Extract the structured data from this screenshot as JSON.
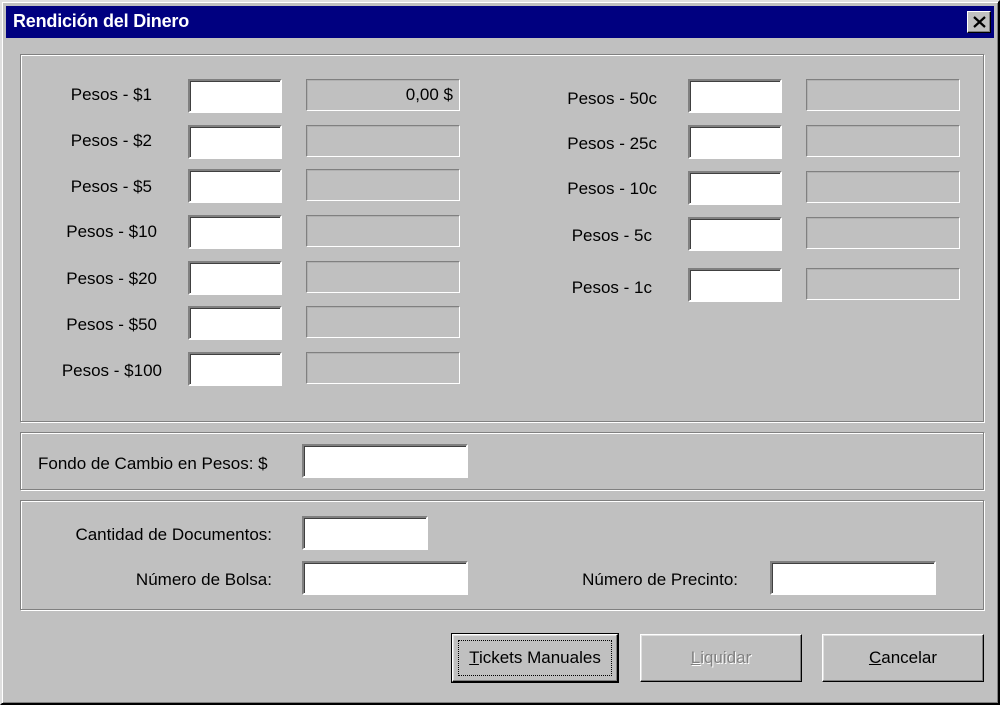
{
  "window": {
    "title": "Rendición del Dinero",
    "close_glyph": "close-icon"
  },
  "billetes": [
    {
      "label": "Pesos - $1",
      "value": "",
      "total": "0,00 $"
    },
    {
      "label": "Pesos - $2",
      "value": "",
      "total": ""
    },
    {
      "label": "Pesos - $5",
      "value": "",
      "total": ""
    },
    {
      "label": "Pesos - $10",
      "value": "",
      "total": ""
    },
    {
      "label": "Pesos - $20",
      "value": "",
      "total": ""
    },
    {
      "label": "Pesos - $50",
      "value": "",
      "total": ""
    },
    {
      "label": "Pesos - $100",
      "value": "",
      "total": ""
    }
  ],
  "monedas": [
    {
      "label": "Pesos - 50c",
      "value": "",
      "total": ""
    },
    {
      "label": "Pesos - 25c",
      "value": "",
      "total": ""
    },
    {
      "label": "Pesos - 10c",
      "value": "",
      "total": ""
    },
    {
      "label": "Pesos - 5c",
      "value": "",
      "total": ""
    },
    {
      "label": "Pesos - 1c",
      "value": "",
      "total": ""
    }
  ],
  "fondo": {
    "label": "Fondo de Cambio en Pesos: $",
    "value": ""
  },
  "documentos": {
    "cantidad_label": "Cantidad de Documentos:",
    "cantidad_value": "",
    "bolsa_label": "Número de Bolsa:",
    "bolsa_value": "",
    "precinto_label": "Número de Precinto:",
    "precinto_value": ""
  },
  "buttons": {
    "tickets_hotkey": "T",
    "tickets_rest": "ickets Manuales",
    "liquidar_hotkey": "L",
    "liquidar_rest": "iquidar",
    "cancelar_hotkey": "C",
    "cancelar_rest": "ancelar"
  }
}
